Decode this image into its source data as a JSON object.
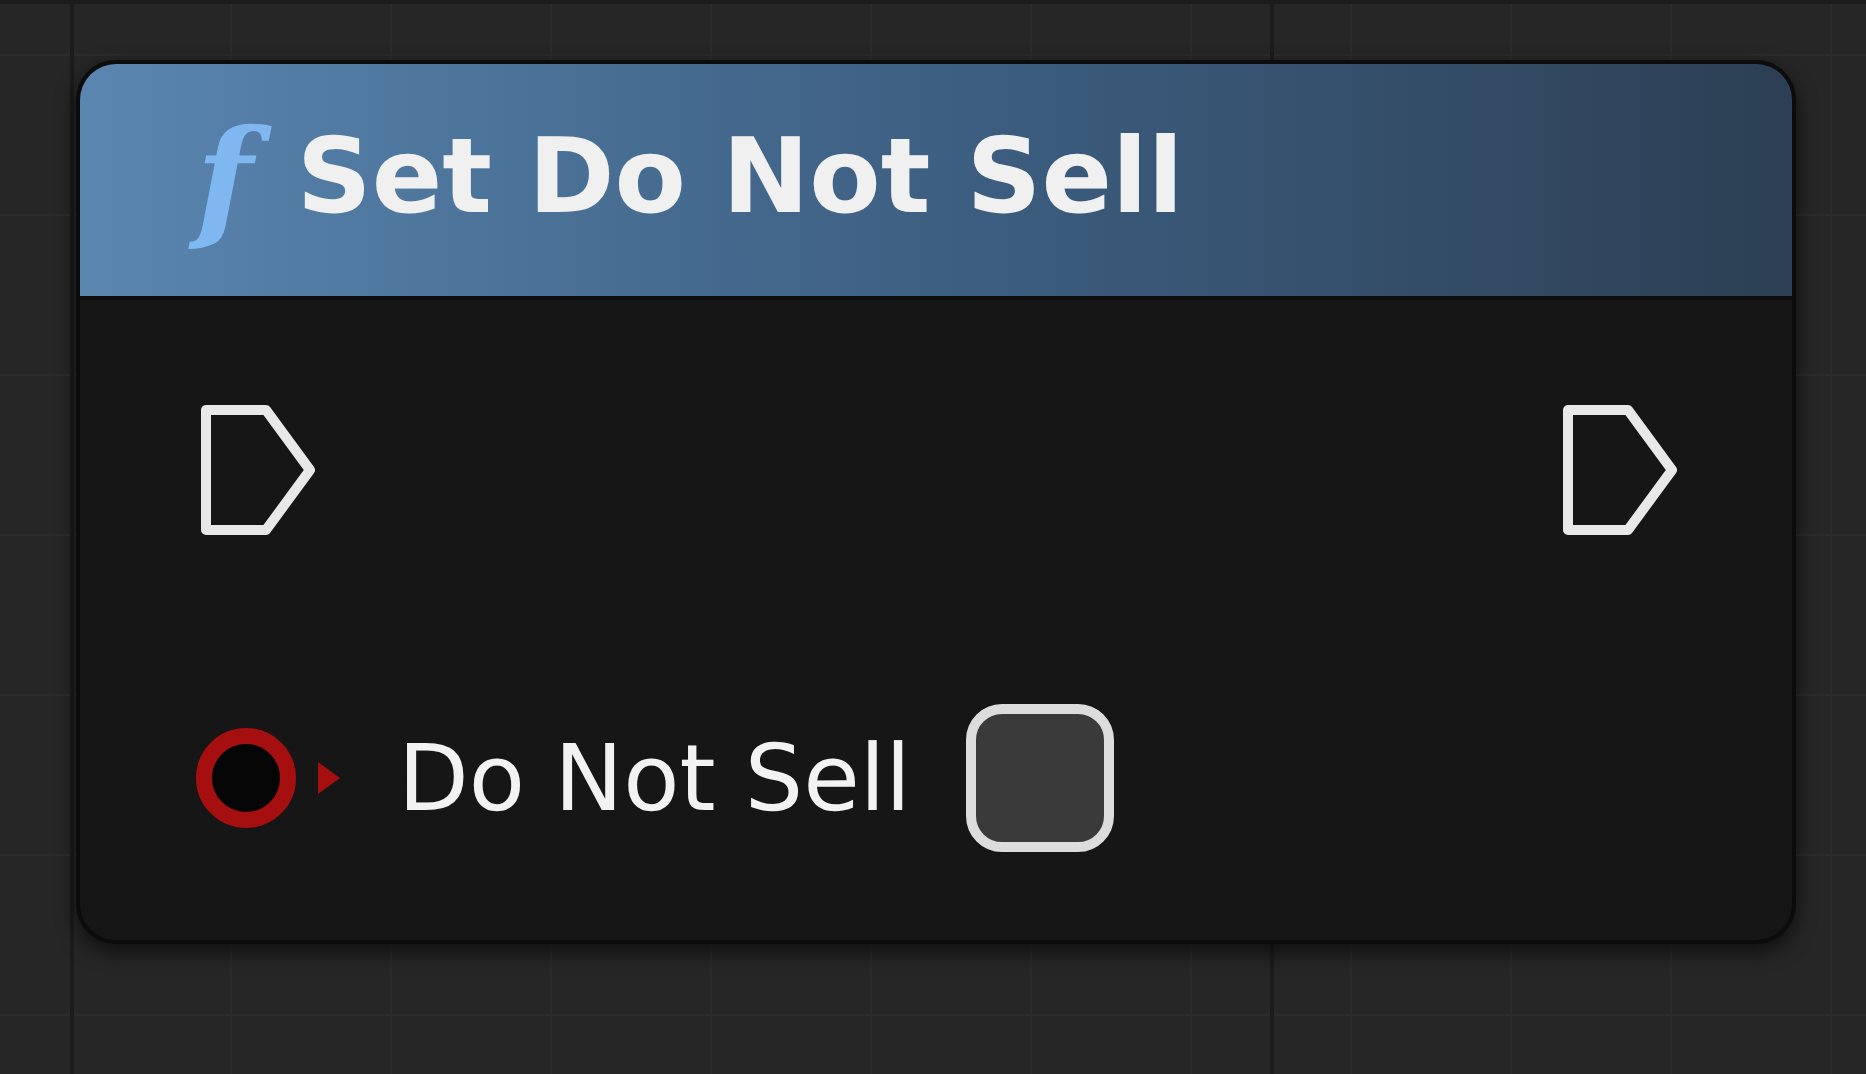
{
  "node": {
    "icon": "f",
    "title": "Set Do Not Sell",
    "exec_pins": [
      {
        "connected": false
      },
      {
        "connected": false
      }
    ],
    "inputs": [
      {
        "kind": "bool",
        "label": "Do Not Sell",
        "checked": false,
        "connected": false,
        "color": "#a50f0f"
      }
    ]
  }
}
